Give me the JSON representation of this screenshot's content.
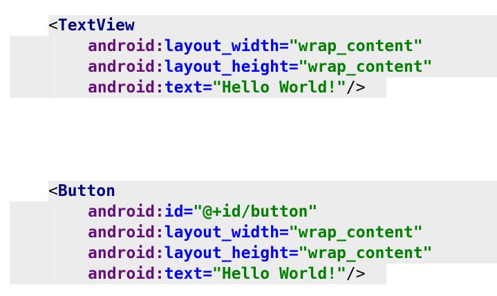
{
  "colors": {
    "tag": "#000080",
    "namespace": "#660e7a",
    "attribute": "#0000ff",
    "value": "#008000",
    "highlight": "#ececec"
  },
  "blocks": [
    {
      "open": "<",
      "tag": "TextView",
      "attributes": [
        {
          "ns": "android",
          "colon": ":",
          "name": "layout_width",
          "eq": "=",
          "value": "\"wrap_content\"",
          "close": ""
        },
        {
          "ns": "android",
          "colon": ":",
          "name": "layout_height",
          "eq": "=",
          "value": "\"wrap_content\"",
          "close": ""
        },
        {
          "ns": "android",
          "colon": ":",
          "name": "text",
          "eq": "=",
          "value": "\"Hello World!\"",
          "close": "/>"
        }
      ]
    },
    {
      "open": "<",
      "tag": "Button",
      "attributes": [
        {
          "ns": "android",
          "colon": ":",
          "name": "id",
          "eq": "=",
          "value": "\"@+id/button\"",
          "close": ""
        },
        {
          "ns": "android",
          "colon": ":",
          "name": "layout_width",
          "eq": "=",
          "value": "\"wrap_content\"",
          "close": ""
        },
        {
          "ns": "android",
          "colon": ":",
          "name": "layout_height",
          "eq": "=",
          "value": "\"wrap_content\"",
          "close": ""
        },
        {
          "ns": "android",
          "colon": ":",
          "name": "text",
          "eq": "=",
          "value": "\"Hello World!\"",
          "close": "/>"
        }
      ]
    }
  ]
}
